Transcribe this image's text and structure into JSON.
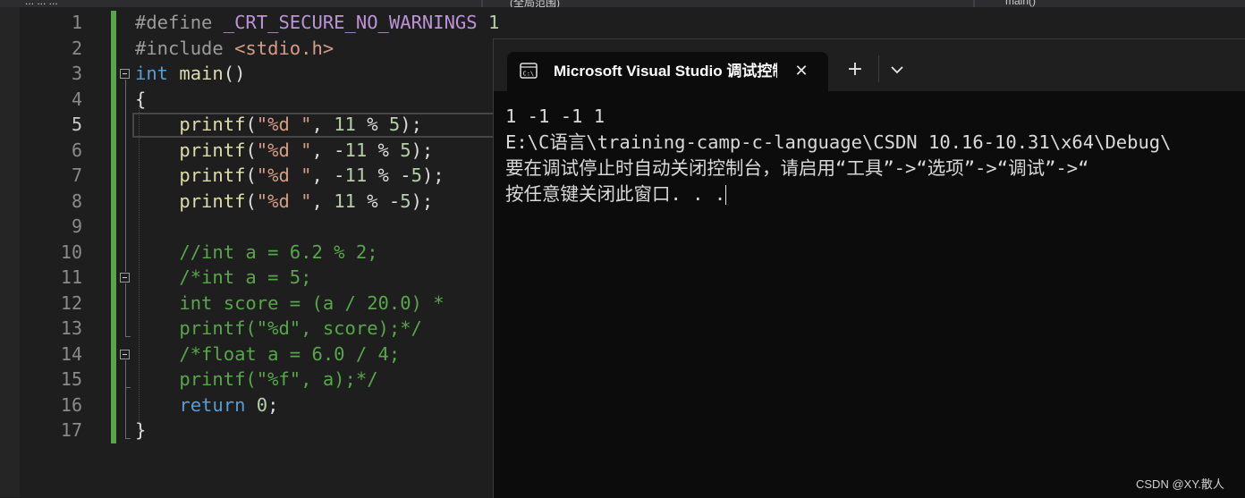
{
  "top_tabs": [
    {
      "label": "...  ...  ..."
    },
    {
      "label": "(全局范围)"
    },
    {
      "label": "main()"
    }
  ],
  "editor": {
    "current_line": 5,
    "line_numbers": [
      "1",
      "2",
      "3",
      "4",
      "5",
      "6",
      "7",
      "8",
      "9",
      "10",
      "11",
      "12",
      "13",
      "14",
      "15",
      "16",
      "17"
    ]
  },
  "console": {
    "tab_title": "Microsoft Visual Studio 调试控制台",
    "close_symbol": "✕",
    "new_tab_symbol": "+",
    "output": [
      "1 -1 -1 1",
      "E:\\C语言\\training-camp-c-language\\CSDN 10.16-10.31\\x64\\Debug\\",
      "要在调试停止时自动关闭控制台，请启用“工具”->“选项”->“调试”->“",
      "按任意键关闭此窗口. . ."
    ]
  },
  "watermark": "CSDN @XY.散人",
  "colors": {
    "editor_bg": "#1e1e1e",
    "console_bg": "#0c0c0c",
    "keyword": "#569cd6",
    "string": "#d69d85",
    "comment": "#57a64a",
    "function": "#dcdcaa",
    "change_bar": "#57a64a"
  }
}
